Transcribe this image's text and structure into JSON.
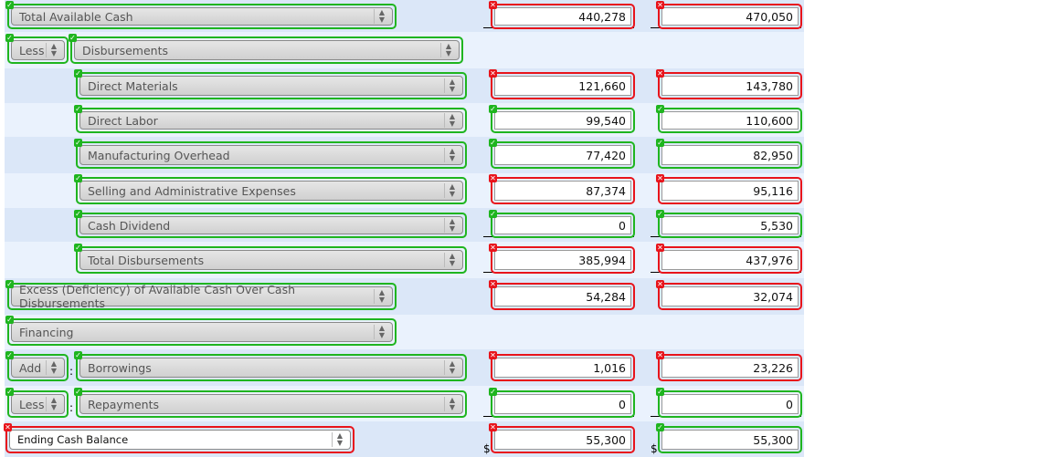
{
  "rows": [
    {
      "selects": [
        {
          "label": "Total Available Cash",
          "ok": true
        }
      ],
      "amounts": [
        {
          "value": "440,278",
          "ok": false
        },
        {
          "value": "470,050",
          "ok": false
        }
      ],
      "underline": true
    },
    {
      "selects": [
        {
          "label": "Less",
          "ok": true
        },
        {
          "label": "Disbursements",
          "ok": true
        }
      ]
    },
    {
      "selects": [
        {
          "label": "Direct Materials",
          "ok": true
        }
      ],
      "amounts": [
        {
          "value": "121,660",
          "ok": false
        },
        {
          "value": "143,780",
          "ok": false
        }
      ]
    },
    {
      "selects": [
        {
          "label": "Direct Labor",
          "ok": true
        }
      ],
      "amounts": [
        {
          "value": "99,540",
          "ok": true
        },
        {
          "value": "110,600",
          "ok": true
        }
      ]
    },
    {
      "selects": [
        {
          "label": "Manufacturing Overhead",
          "ok": true
        }
      ],
      "amounts": [
        {
          "value": "77,420",
          "ok": true
        },
        {
          "value": "82,950",
          "ok": true
        }
      ]
    },
    {
      "selects": [
        {
          "label": "Selling and Administrative Expenses",
          "ok": true
        }
      ],
      "amounts": [
        {
          "value": "87,374",
          "ok": false
        },
        {
          "value": "95,116",
          "ok": false
        }
      ]
    },
    {
      "selects": [
        {
          "label": "Cash Dividend",
          "ok": true
        }
      ],
      "amounts": [
        {
          "value": "0",
          "ok": true
        },
        {
          "value": "5,530",
          "ok": true
        }
      ],
      "underline": true
    },
    {
      "selects": [
        {
          "label": "Total Disbursements",
          "ok": true
        }
      ],
      "amounts": [
        {
          "value": "385,994",
          "ok": false
        },
        {
          "value": "437,976",
          "ok": false
        }
      ],
      "underline": true
    },
    {
      "selects": [
        {
          "label": "Excess (Deficiency) of Available Cash Over Cash Disbursements",
          "ok": true
        }
      ],
      "amounts": [
        {
          "value": "54,284",
          "ok": false
        },
        {
          "value": "32,074",
          "ok": false
        }
      ]
    },
    {
      "selects": [
        {
          "label": "Financing",
          "ok": true
        }
      ]
    },
    {
      "selects": [
        {
          "label": "Add",
          "ok": true
        },
        {
          "label": "Borrowings",
          "ok": true
        }
      ],
      "amounts": [
        {
          "value": "1,016",
          "ok": false
        },
        {
          "value": "23,226",
          "ok": false
        }
      ]
    },
    {
      "selects": [
        {
          "label": "Less",
          "ok": true
        },
        {
          "label": "Repayments",
          "ok": true
        }
      ],
      "amounts": [
        {
          "value": "0",
          "ok": true
        },
        {
          "value": "0",
          "ok": true
        }
      ],
      "underline": true
    },
    {
      "selects": [
        {
          "label": "Ending Cash Balance",
          "ok": false
        }
      ],
      "amounts": [
        {
          "value": "55,300",
          "ok": false
        },
        {
          "value": "55,300",
          "ok": true
        }
      ],
      "dollar": "$"
    }
  ]
}
